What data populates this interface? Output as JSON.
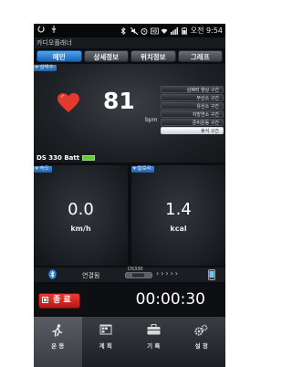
{
  "status_bar": {
    "time": "오전 9:54"
  },
  "app_title": "카디오플래너",
  "tabs": [
    {
      "label": "메인",
      "active": true
    },
    {
      "label": "상세정보",
      "active": false
    },
    {
      "label": "위치정보",
      "active": false
    },
    {
      "label": "그래프",
      "active": false
    }
  ],
  "heart_rate": {
    "section_label": "심박수",
    "value": "81",
    "unit": "bpm",
    "zones": [
      "심폐력 향상 구간",
      "무산소 구간",
      "유산소 구간",
      "지방연소 구간",
      "준비운동 구간",
      "휴식 구간"
    ],
    "selected_zone_index": 5
  },
  "device": {
    "name": "DS 330 Batt"
  },
  "speed": {
    "section_label": "속도",
    "value": "0.0",
    "unit": "km/h"
  },
  "calories": {
    "section_label": "칼로리",
    "value": "1.4",
    "unit": "kcal"
  },
  "connection": {
    "status": "연결됨",
    "device_tag": "DS330"
  },
  "controls": {
    "stop_label": "종 료",
    "timer": "00:00:30"
  },
  "bottom_nav": [
    {
      "label": "운 동",
      "icon": "running-icon",
      "active": true
    },
    {
      "label": "계 획",
      "icon": "calendar-icon",
      "active": false
    },
    {
      "label": "기 록",
      "icon": "briefcase-icon",
      "active": false
    },
    {
      "label": "설 정",
      "icon": "gears-icon",
      "active": false
    }
  ],
  "colors": {
    "accent_blue": "#1c63b6",
    "heart_red": "#e23a2e",
    "stop_red": "#d62420",
    "battery_green": "#67c63a"
  }
}
